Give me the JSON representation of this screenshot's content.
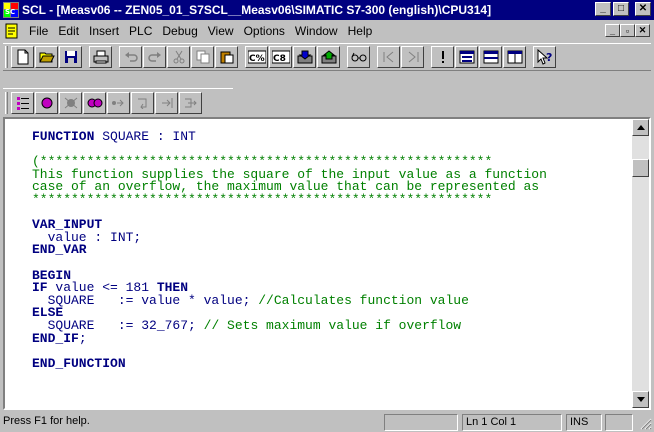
{
  "window": {
    "title": "SCL  - [Measv06 -- ZEN05_01_S7SCL__Measv06\\SIMATIC S7-300 (english)\\CPU314]",
    "minimize": "_",
    "restore": "□",
    "close": "✕"
  },
  "menu": {
    "items": [
      "File",
      "Edit",
      "Insert",
      "PLC",
      "Debug",
      "View",
      "Options",
      "Window",
      "Help"
    ],
    "mdi_minimize": "_",
    "mdi_restore": "▫",
    "mdi_close": "✕"
  },
  "toolbar1": {
    "buttons": [
      "new-document",
      "open-folder",
      "save",
      "print",
      "undo",
      "redo",
      "cut",
      "copy",
      "paste",
      "compile",
      "compile-all",
      "download",
      "monitor",
      "glasses",
      "breakpoint-prev",
      "breakpoint-next",
      "important",
      "window-a",
      "window-b",
      "window-c",
      "help-pointer"
    ]
  },
  "toolbar2": {
    "buttons": [
      "list",
      "breakpoint",
      "delete-breakpoint",
      "breakpoints-active",
      "step",
      "step-into",
      "step-out",
      "run-to-cursor"
    ]
  },
  "editor": {
    "lines": [
      [
        {
          "t": "FUNCTION ",
          "c": "kw"
        },
        {
          "t": "SQUARE : INT",
          "c": "plain"
        }
      ],
      [],
      [
        {
          "t": "(**********************************************************",
          "c": "cmt"
        }
      ],
      [
        {
          "t": "This function supplies the square of the input value as a function",
          "c": "cmt"
        }
      ],
      [
        {
          "t": "case of an overflow, the maximum value that can be represented as",
          "c": "cmt"
        }
      ],
      [
        {
          "t": "***********************************************************",
          "c": "cmt"
        }
      ],
      [],
      [
        {
          "t": "VAR_INPUT",
          "c": "kw"
        }
      ],
      [
        {
          "t": "  value : INT;",
          "c": "plain"
        }
      ],
      [
        {
          "t": "END_VAR",
          "c": "kw"
        }
      ],
      [],
      [
        {
          "t": "BEGIN",
          "c": "kw"
        }
      ],
      [
        {
          "t": "IF ",
          "c": "kw"
        },
        {
          "t": "value <= 181 ",
          "c": "plain"
        },
        {
          "t": "THEN",
          "c": "kw"
        }
      ],
      [
        {
          "t": "  SQUARE   := value * value; ",
          "c": "plain"
        },
        {
          "t": "//Calculates function value",
          "c": "cmt"
        }
      ],
      [
        {
          "t": "ELSE",
          "c": "kw"
        }
      ],
      [
        {
          "t": "  SQUARE   := 32_767; ",
          "c": "plain"
        },
        {
          "t": "// Sets maximum value if overflow",
          "c": "cmt"
        }
      ],
      [
        {
          "t": "END_IF",
          "c": "kw"
        },
        {
          "t": ";",
          "c": "plain"
        }
      ],
      [],
      [
        {
          "t": "END_FUNCTION",
          "c": "kw"
        }
      ]
    ]
  },
  "status": {
    "help": "Press F1 for help.",
    "panel1": "",
    "position": "Ln 1 Col 1",
    "mode": "INS",
    "panel4": ""
  },
  "colors": {
    "titlebar": "#000080",
    "keyword": "#000080",
    "comment": "#008000",
    "face": "#c0c0c0"
  }
}
